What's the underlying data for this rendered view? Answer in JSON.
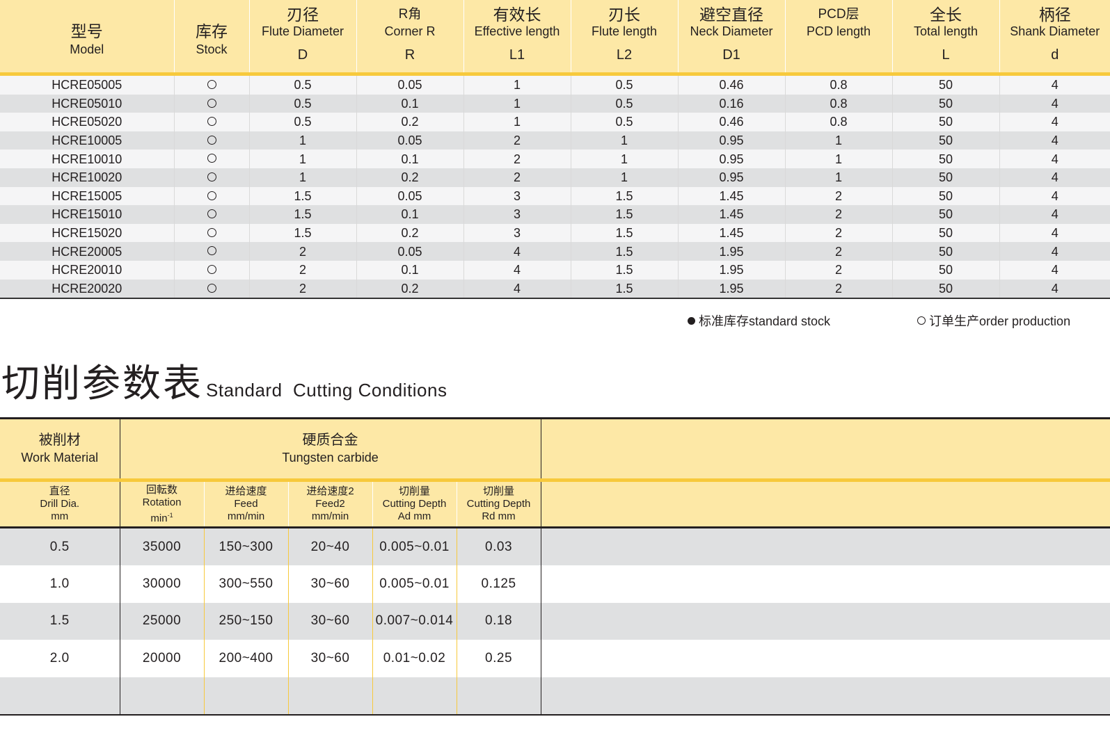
{
  "spec_table": {
    "headers": [
      {
        "zh": "型号",
        "en": "Model",
        "sym": ""
      },
      {
        "zh": "库存",
        "en": "Stock",
        "sym": ""
      },
      {
        "zh": "刃径",
        "en": "Flute Diameter",
        "sym": "D"
      },
      {
        "zh": "R角",
        "en": "Corner R",
        "sym": "R"
      },
      {
        "zh": "有效长",
        "en": "Effective length",
        "sym": "L1"
      },
      {
        "zh": "刃长",
        "en": "Flute length",
        "sym": "L2"
      },
      {
        "zh": "避空直径",
        "en": "Neck Diameter",
        "sym": "D1"
      },
      {
        "zh": "PCD层",
        "en": "PCD length",
        "sym": ""
      },
      {
        "zh": "全长",
        "en": "Total length",
        "sym": "L"
      },
      {
        "zh": "柄径",
        "en": "Shank Diameter",
        "sym": "d"
      }
    ],
    "rows": [
      [
        "HCRE05005",
        "O",
        "0.5",
        "0.05",
        "1",
        "0.5",
        "0.46",
        "0.8",
        "50",
        "4"
      ],
      [
        "HCRE05010",
        "O",
        "0.5",
        "0.1",
        "1",
        "0.5",
        "0.16",
        "0.8",
        "50",
        "4"
      ],
      [
        "HCRE05020",
        "O",
        "0.5",
        "0.2",
        "1",
        "0.5",
        "0.46",
        "0.8",
        "50",
        "4"
      ],
      [
        "HCRE10005",
        "O",
        "1",
        "0.05",
        "2",
        "1",
        "0.95",
        "1",
        "50",
        "4"
      ],
      [
        "HCRE10010",
        "O",
        "1",
        "0.1",
        "2",
        "1",
        "0.95",
        "1",
        "50",
        "4"
      ],
      [
        "HCRE10020",
        "O",
        "1",
        "0.2",
        "2",
        "1",
        "0.95",
        "1",
        "50",
        "4"
      ],
      [
        "HCRE15005",
        "O",
        "1.5",
        "0.05",
        "3",
        "1.5",
        "1.45",
        "2",
        "50",
        "4"
      ],
      [
        "HCRE15010",
        "O",
        "1.5",
        "0.1",
        "3",
        "1.5",
        "1.45",
        "2",
        "50",
        "4"
      ],
      [
        "HCRE15020",
        "O",
        "1.5",
        "0.2",
        "3",
        "1.5",
        "1.45",
        "2",
        "50",
        "4"
      ],
      [
        "HCRE20005",
        "O",
        "2",
        "0.05",
        "4",
        "1.5",
        "1.95",
        "2",
        "50",
        "4"
      ],
      [
        "HCRE20010",
        "O",
        "2",
        "0.1",
        "4",
        "1.5",
        "1.95",
        "2",
        "50",
        "4"
      ],
      [
        "HCRE20020",
        "O",
        "2",
        "0.2",
        "4",
        "1.5",
        "1.95",
        "2",
        "50",
        "4"
      ]
    ]
  },
  "legend": {
    "standard_stock": "标准库存standard stock",
    "order_production": "订单生产order production"
  },
  "section_title": {
    "zh": "切削参数表",
    "en": "Standard  Cutting Conditions"
  },
  "cutting_table": {
    "work_material_zh": "被削材",
    "work_material_en": "Work Material",
    "material_zh": "硬质合金",
    "material_en": "Tungsten carbide",
    "sub_headers": [
      {
        "l1": "直径",
        "l2": "Drill Dia.",
        "l3": "mm"
      },
      {
        "l1": "回転数",
        "l2": "Rotation",
        "l3": "min"
      },
      {
        "l1": "进给速度",
        "l2": "Feed",
        "l3": "mm/min"
      },
      {
        "l1": "进给速度2",
        "l2": "Feed2",
        "l3": "mm/min"
      },
      {
        "l1": "切削量",
        "l2": "Cutting Depth",
        "l3": "Ad mm"
      },
      {
        "l1": "切削量",
        "l2": "Cutting Depth",
        "l3": "Rd mm"
      }
    ],
    "rotation_sup": "-1",
    "rows": [
      [
        "0.5",
        "35000",
        "150~300",
        "20~40",
        "0.005~0.01",
        "0.03"
      ],
      [
        "1.0",
        "30000",
        "300~550",
        "30~60",
        "0.005~0.01",
        "0.125"
      ],
      [
        "1.5",
        "25000",
        "250~150",
        "30~60",
        "0.007~0.014",
        "0.18"
      ],
      [
        "2.0",
        "20000",
        "200~400",
        "30~60",
        "0.01~0.02",
        "0.25"
      ],
      [
        "",
        "",
        "",
        "",
        "",
        ""
      ]
    ]
  }
}
